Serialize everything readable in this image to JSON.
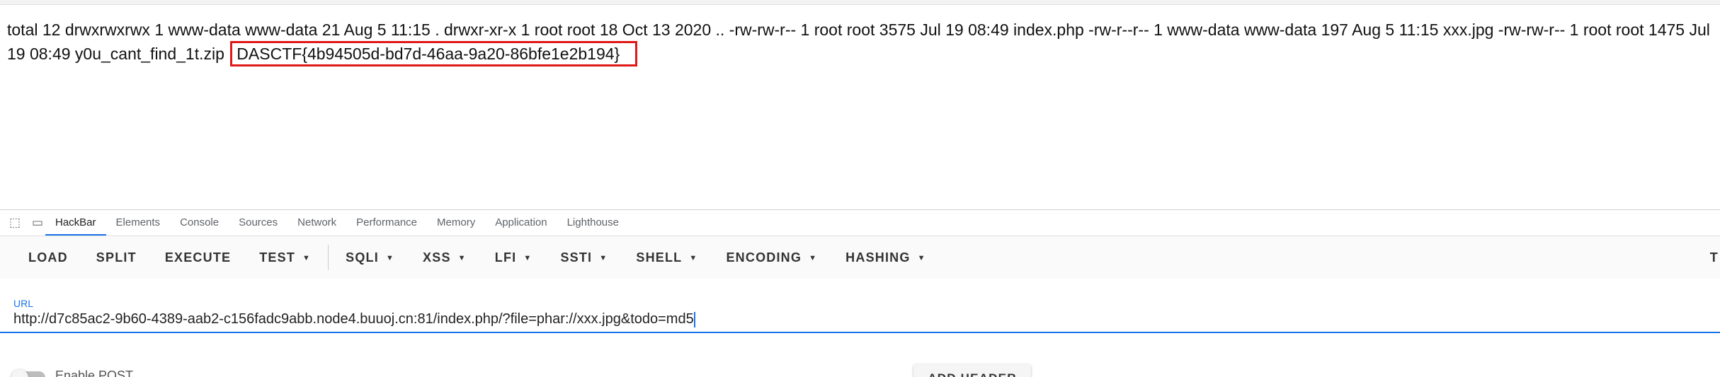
{
  "page": {
    "listing": "total 12 drwxrwxrwx 1 www-data www-data 21 Aug 5 11:15 . drwxr-xr-x 1 root root 18 Oct 13 2020 .. -rw-rw-r-- 1 root root 3575 Jul 19 08:49 index.php -rw-r--r-- 1 www-data www-data 197 Aug 5 11:15 xxx.jpg -rw-rw-r-- 1 root root 1475 Jul 19 08:49 y0u_cant_find_1t.zip",
    "flag": "DASCTF{4b94505d-bd7d-46aa-9a20-86bfe1e2b194}"
  },
  "devtools": {
    "tabs": [
      "HackBar",
      "Elements",
      "Console",
      "Sources",
      "Network",
      "Performance",
      "Memory",
      "Application",
      "Lighthouse"
    ],
    "active_tab": "HackBar"
  },
  "hackbar": {
    "buttons": [
      "LOAD",
      "SPLIT",
      "EXECUTE",
      "TEST",
      "SQLI",
      "XSS",
      "LFI",
      "SSTI",
      "SHELL",
      "ENCODING",
      "HASHING"
    ],
    "right_cut_label": "T",
    "url_label": "URL",
    "url_value": "http://d7c85ac2-9b60-4389-aab2-c156fadc9abb.node4.buuoj.cn:81/index.php/?file=phar://xxx.jpg&todo=md5",
    "post_label": "Enable POST",
    "add_header_label": "ADD HEADER"
  },
  "colors": {
    "accent": "#1a73e8",
    "highlight_box": "#e01818"
  },
  "icons": [
    "inspect-element-icon",
    "device-toolbar-icon",
    "chevron-down-icon"
  ]
}
